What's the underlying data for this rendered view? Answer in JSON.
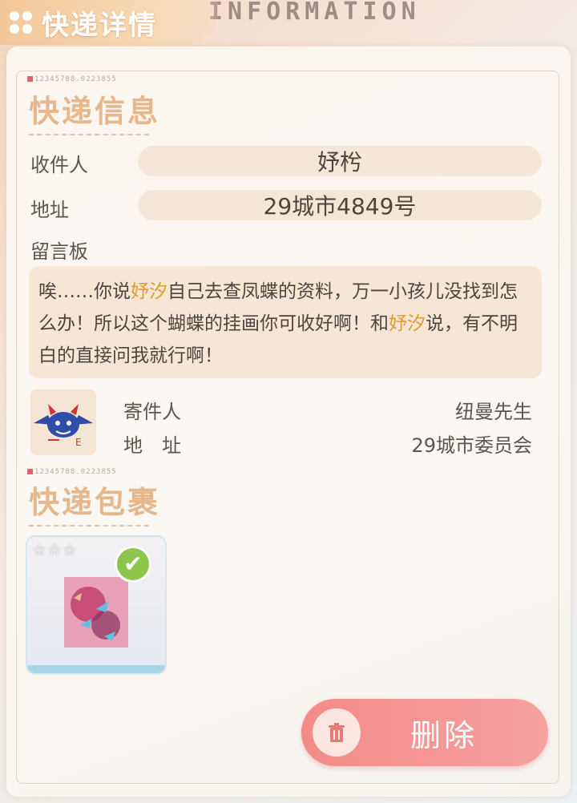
{
  "header": {
    "title": "快递详情",
    "deco_text": "INFORMATION"
  },
  "info": {
    "serial": "12345788.0223855",
    "section_title": "快递信息",
    "recipient_label": "收件人",
    "recipient_value": "妤枍",
    "address_label": "地址",
    "address_value": "29城市4849号",
    "message_label": "留言板",
    "message_parts": [
      "唉……你说",
      "妤汐",
      "自己去查凤蝶的资料，万一小孩儿没找到怎么办！所以这个蝴蝶的挂画你可收好啊！和",
      "妤汐",
      "说，有不明白的直接问我就行啊！"
    ]
  },
  "sender": {
    "sender_label": "寄件人",
    "sender_value": "纽曼先生",
    "address_label": "地　址",
    "address_value": "29城市委员会"
  },
  "package": {
    "serial": "12345788.0223855",
    "section_title": "快递包裹",
    "stars": "☆☆☆",
    "check": "✔"
  },
  "actions": {
    "delete_label": "删除"
  },
  "colors": {
    "accent": "#e6b78c",
    "highlight": "#e39a2e",
    "delete": "#f48a88"
  }
}
